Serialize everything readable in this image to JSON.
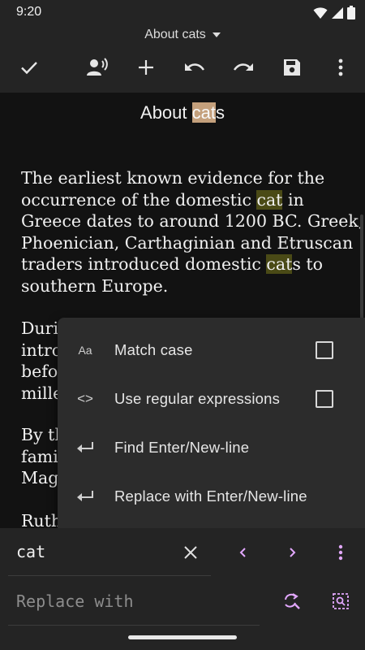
{
  "status_bar": {
    "time": "9:20"
  },
  "header": {
    "document_title": "About cats",
    "toolbar": [
      "check-icon",
      "read-aloud-icon",
      "add-icon",
      "undo-icon",
      "redo-icon",
      "save-icon",
      "more-vert-icon"
    ]
  },
  "editor": {
    "title_before": "About ",
    "title_match": "cat",
    "title_after": "s",
    "p1": {
      "l1": "The earliest known evidence for the",
      "l2_before": "occurrence of the domestic ",
      "l2_match": "cat",
      "l2_after": " in",
      "l3": "Greece dates to around 1200 BC. Greek,",
      "l4": "Phoenician, Carthaginian and Etruscan",
      "l5_before": "traders introduced domestic ",
      "l5_match": "cat",
      "l5_after": "s to",
      "l6": "southern Europe."
    },
    "p2": {
      "l1": "Durin",
      "l2": "intro",
      "l3": "befo",
      "l4": "mille"
    },
    "p3": {
      "l1": "By th",
      "l2": "fami",
      "l3": "Mag"
    },
    "p4": {
      "l1": "Ruth"
    }
  },
  "overflow_menu": {
    "items": [
      {
        "icon": "text-case-icon",
        "icon_glyph": "Aa",
        "label": "Match case",
        "checked": false
      },
      {
        "icon": "code-icon",
        "icon_glyph": "<>",
        "label": "Use regular expressions",
        "checked": false
      },
      {
        "icon": "enter-key-icon",
        "label": "Find Enter/New-line"
      },
      {
        "icon": "enter-key-icon",
        "label": "Replace with Enter/New-line"
      }
    ]
  },
  "find_bar": {
    "find_value": "cat",
    "replace_placeholder": "Replace with",
    "accent_color": "#e3a8ff"
  }
}
